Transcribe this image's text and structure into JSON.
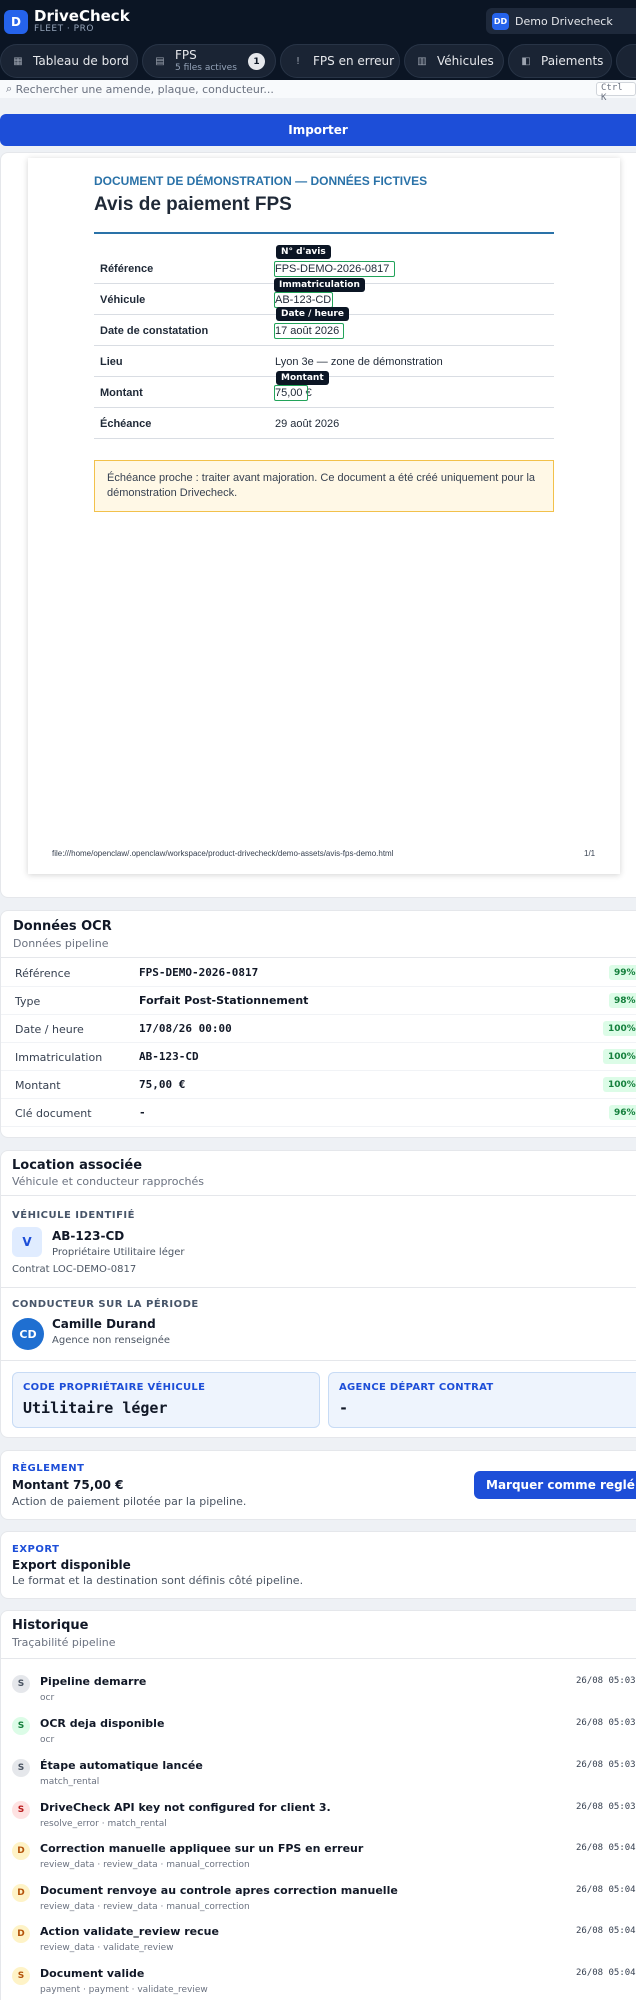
{
  "app": {
    "logo_letter": "D",
    "name": "DriveCheck",
    "subtitle": "FLEET · PRO",
    "org_initials": "DD",
    "org_name": "Demo Drivecheck"
  },
  "nav": [
    {
      "label": "Tableau de bord",
      "icon": "dashboard-icon",
      "glyph": "▦"
    },
    {
      "label": "FPS",
      "sub": "5 files actives",
      "count": "1",
      "icon": "fps-icon",
      "glyph": "▤"
    },
    {
      "label": "FPS en erreur",
      "icon": "alert-icon",
      "glyph": "!"
    },
    {
      "label": "Véhicules",
      "icon": "vehicle-icon",
      "glyph": "▥"
    },
    {
      "label": "Paiements",
      "icon": "payment-icon",
      "glyph": "◧"
    }
  ],
  "search": {
    "placeholder": "Rechercher une amende, plaque, conducteur...",
    "shortcut": "Ctrl K"
  },
  "import_label": "Importer",
  "document": {
    "kicker": "DOCUMENT DE DÉMONSTRATION — DONNÉES FICTIVES",
    "title": "Avis de paiement FPS",
    "rows": [
      {
        "label": "Référence",
        "value": "FPS-DEMO-2026-0817"
      },
      {
        "label": "Véhicule",
        "value": "AB-123-CD"
      },
      {
        "label": "Date de constatation",
        "value": "17 août 2026"
      },
      {
        "label": "Lieu",
        "value": "Lyon 3e — zone de démonstration"
      },
      {
        "label": "Montant",
        "value": "75,00 €"
      },
      {
        "label": "Échéance",
        "value": "29 août 2026"
      }
    ],
    "tags": {
      "reference": "N° d'avis",
      "plate": "Immatriculation",
      "date": "Date / heure",
      "amount": "Montant"
    },
    "warning": "Échéance proche : traiter avant majoration. Ce document a été créé uniquement pour la démonstration Drivecheck.",
    "footer_path": "file:///home/openclaw/.openclaw/workspace/product-drivecheck/demo-assets/avis-fps-demo.html",
    "page": "1/1"
  },
  "ocr": {
    "title": "Données OCR",
    "subtitle": "Données pipeline",
    "rows": [
      {
        "key": "Référence",
        "value": "FPS-DEMO-2026-0817",
        "conf": "99%",
        "mono": true
      },
      {
        "key": "Type",
        "value": "Forfait Post-Stationnement",
        "conf": "98%",
        "mono": false
      },
      {
        "key": "Date / heure",
        "value": "17/08/26 00:00",
        "conf": "100%",
        "mono": true
      },
      {
        "key": "Immatriculation",
        "value": "AB-123-CD",
        "conf": "100%",
        "mono": true
      },
      {
        "key": "Montant",
        "value": "75,00 €",
        "conf": "100%",
        "mono": true
      },
      {
        "key": "Clé document",
        "value": "-",
        "conf": "96%",
        "mono": true
      }
    ]
  },
  "rental": {
    "title": "Location associée",
    "subtitle": "Véhicule et conducteur rapprochés",
    "vehicle_caption": "VÉHICULE IDENTIFIÉ",
    "vehicle_letter": "V",
    "plate": "AB-123-CD",
    "owner": "Propriétaire Utilitaire léger",
    "contract": "Contrat LOC-DEMO-0817",
    "driver_caption": "CONDUCTEUR SUR LA PÉRIODE",
    "driver_initials": "CD",
    "driver_name": "Camille Durand",
    "agency": "Agence non renseignée",
    "owner_code_caption": "CODE PROPRIÉTAIRE VÉHICULE",
    "owner_code": "Utilitaire léger",
    "agency_caption": "AGENCE DÉPART CONTRAT",
    "agency_value": "-"
  },
  "payment": {
    "caption": "RÈGLEMENT",
    "amount": "Montant 75,00 €",
    "note": "Action de paiement pilotée par la pipeline.",
    "button": "Marquer comme reglé"
  },
  "export": {
    "caption": "EXPORT",
    "title": "Export disponible",
    "note": "Le format et la destination sont définis côté pipeline."
  },
  "history": {
    "title": "Historique",
    "subtitle": "Traçabilité pipeline",
    "events": [
      {
        "letter": "S",
        "kind": "neutral",
        "title": "Pipeline demarre",
        "detail": "ocr",
        "time": "26/08 05:03"
      },
      {
        "letter": "S",
        "kind": "success",
        "title": "OCR deja disponible",
        "detail": "ocr",
        "time": "26/08 05:03"
      },
      {
        "letter": "S",
        "kind": "neutral",
        "title": "Étape automatique lancée",
        "detail": "match_rental",
        "time": "26/08 05:03"
      },
      {
        "letter": "S",
        "kind": "error",
        "title": "DriveCheck API key not configured for client 3.",
        "detail": "resolve_error · match_rental",
        "time": "26/08 05:03"
      },
      {
        "letter": "D",
        "kind": "warning",
        "title": "Correction manuelle appliquee sur un FPS en erreur",
        "detail": "review_data · review_data · manual_correction",
        "time": "26/08 05:04"
      },
      {
        "letter": "D",
        "kind": "warning",
        "title": "Document renvoye au controle apres correction manuelle",
        "detail": "review_data · review_data · manual_correction",
        "time": "26/08 05:04"
      },
      {
        "letter": "D",
        "kind": "warning",
        "title": "Action validate_review recue",
        "detail": "review_data · validate_review",
        "time": "26/08 05:04"
      },
      {
        "letter": "S",
        "kind": "warning",
        "title": "Document valide",
        "detail": "payment · payment · validate_review",
        "time": "26/08 05:04"
      }
    ]
  },
  "colors": {
    "neutral": "#e5e7eb",
    "neutral_text": "#4b5563",
    "success": "#dcfce7",
    "success_text": "#15803d",
    "error": "#fee2e2",
    "error_text": "#b91c1c",
    "warning": "#fef3c7",
    "warning_text": "#b45309"
  }
}
